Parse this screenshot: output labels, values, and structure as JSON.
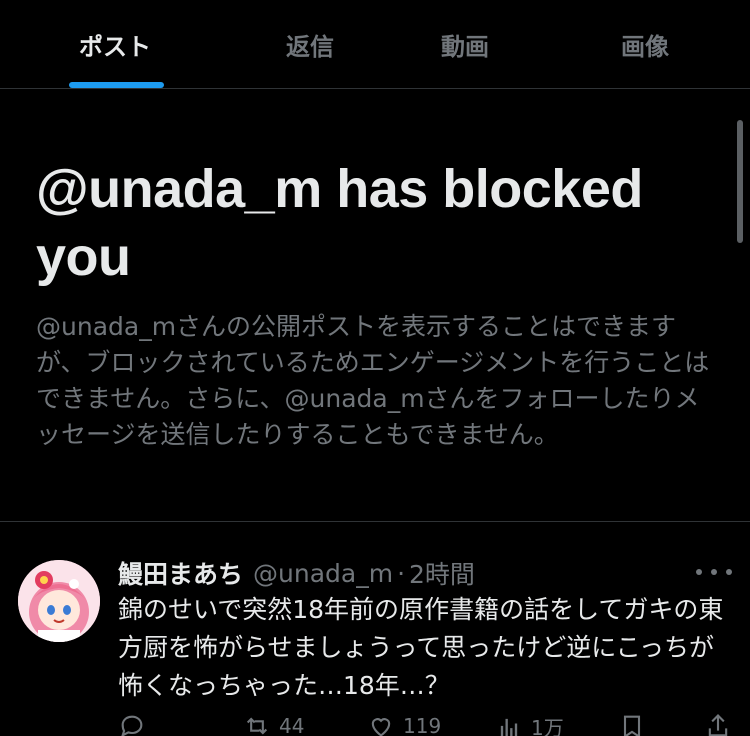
{
  "tabs": [
    {
      "label": "ポスト",
      "active": true
    },
    {
      "label": "返信",
      "active": false
    },
    {
      "label": "動画",
      "active": false
    },
    {
      "label": "画像",
      "active": false
    }
  ],
  "blocked": {
    "title": "@unada_m has blocked you",
    "description": "@unada_mさんの公開ポストを表示することはできますが、ブロックされているためエンゲージメントを行うことはできません。さらに、@unada_mさんをフォローしたりメッセージを送信したりすることもできません。"
  },
  "post": {
    "author_name": "鰻田まあち",
    "handle": "@unada_m",
    "separator": "·",
    "time": "2時間",
    "text": "錦のせいで突然18年前の原作書籍の話をしてガキの東方厨を怖がらせましょうって思ったけど逆にこっちが怖くなっちゃった…18年…？",
    "actions": {
      "reply_icon": "reply-icon",
      "repost_count": "44",
      "like_count": "119",
      "views_count": "1万",
      "bookmark_icon": "bookmark-icon",
      "share_icon": "share-icon"
    }
  },
  "colors": {
    "accent": "#1d9bf0",
    "text_primary": "#e7e9ea",
    "text_secondary": "#71767b",
    "background": "#000000",
    "divider": "#2f3336"
  }
}
